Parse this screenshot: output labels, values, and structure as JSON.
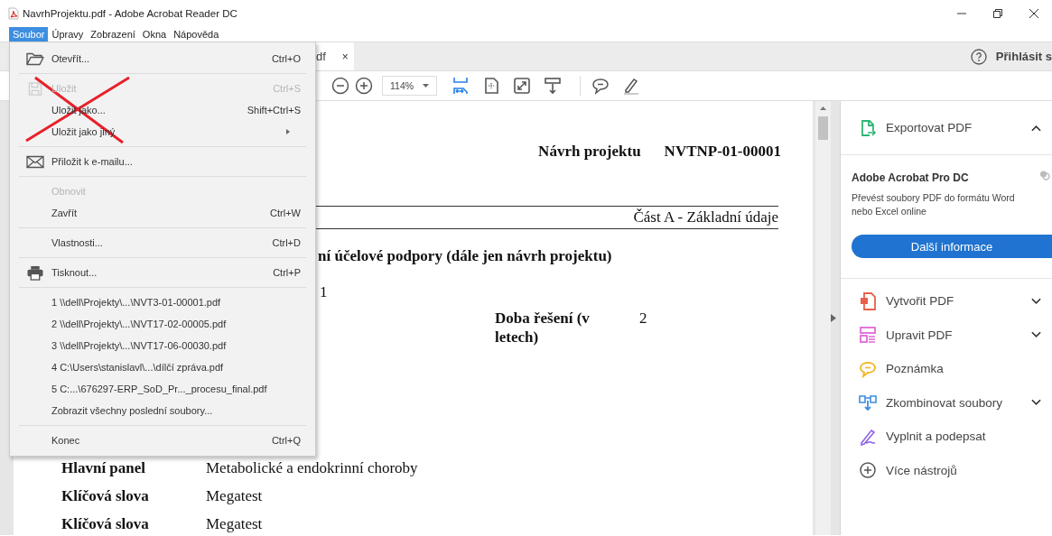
{
  "window": {
    "title": "NavrhProjektu.pdf - Adobe Acrobat Reader DC"
  },
  "menu_bar": [
    {
      "label": "Soubor",
      "selected": true
    },
    {
      "label": "Úpravy",
      "selected": false
    },
    {
      "label": "Zobrazení",
      "selected": false
    },
    {
      "label": "Okna",
      "selected": false
    },
    {
      "label": "Nápověda",
      "selected": false
    }
  ],
  "file_menu": {
    "groups": [
      [
        {
          "label": "Otevřít...",
          "shortcut": "Ctrl+O",
          "disabled": false,
          "submenu": false
        }
      ],
      [
        {
          "label": "Uložit",
          "shortcut": "Ctrl+S",
          "disabled": true,
          "submenu": false
        },
        {
          "label": "Uložit jako...",
          "shortcut": "Shift+Ctrl+S",
          "disabled": false,
          "submenu": false
        },
        {
          "label": "Uložit jako jiný",
          "disabled": false,
          "submenu": true
        }
      ],
      [
        {
          "label": "Přiložit k e-mailu...",
          "disabled": false,
          "submenu": false
        }
      ],
      [
        {
          "label": "Obnovit",
          "disabled": true,
          "submenu": false
        },
        {
          "label": "Zavřít",
          "shortcut": "Ctrl+W",
          "disabled": false,
          "submenu": false
        }
      ],
      [
        {
          "label": "Vlastnosti...",
          "shortcut": "Ctrl+D",
          "disabled": false,
          "submenu": false
        }
      ],
      [
        {
          "label": "Tisknout...",
          "shortcut": "Ctrl+P",
          "disabled": false,
          "submenu": false
        }
      ],
      [
        {
          "label": "1 \\\\dell\\Projekty\\...\\NVT3-01-00001.pdf",
          "disabled": false,
          "submenu": false
        },
        {
          "label": "2 \\\\dell\\Projekty\\...\\NVT17-02-00005.pdf",
          "disabled": false,
          "submenu": false
        },
        {
          "label": "3 \\\\dell\\Projekty\\...\\NVT17-06-00030.pdf",
          "disabled": false,
          "submenu": false
        },
        {
          "label": "4 C:\\Users\\stanislavl\\...\\dílčí zpráva.pdf",
          "disabled": false,
          "submenu": false
        },
        {
          "label": "5 C:...\\676297-ERP_SoD_Pr..._procesu_final.pdf",
          "disabled": false,
          "submenu": false
        },
        {
          "label": "Zobrazit všechny poslední soubory...",
          "disabled": false,
          "submenu": false
        }
      ],
      [
        {
          "label": "Konec",
          "shortcut": "Ctrl+Q",
          "disabled": false,
          "submenu": false
        }
      ]
    ]
  },
  "tab": {
    "label": "df",
    "close": "×"
  },
  "account": {
    "label": "Přihlásit s"
  },
  "toolbar": {
    "zoom": "114%",
    "view_buttons": [
      {
        "selected": true
      },
      {
        "selected": false
      },
      {
        "selected": false
      },
      {
        "selected": false
      }
    ]
  },
  "document": {
    "title": "Návrh projektu",
    "code": "NVTNP-01-00001",
    "section": "Část A - Základní údaje",
    "heading": "ní účelové podpory (dále jen návrh projektu)",
    "fragment": "1",
    "duration": {
      "label": "Doba řešení (v letech)",
      "value": "2"
    },
    "rows": [
      {
        "label": "Hlavní panel",
        "value": "Metabolické a endokrinní choroby"
      },
      {
        "label": "Klíčová slova",
        "value": "Megatest"
      },
      {
        "label": "Klíčová slova",
        "value": "Megatest"
      }
    ]
  },
  "right_panel": {
    "export": {
      "label": "Exportovat PDF",
      "expanded": true
    },
    "promo": {
      "title": "Adobe Acrobat Pro DC",
      "text": "Převést soubory PDF do formátu Word nebo Excel online",
      "button": "Další informace"
    },
    "tools": [
      {
        "label": "Vytvořit PDF",
        "submenu": true
      },
      {
        "label": "Upravit PDF",
        "submenu": true
      },
      {
        "label": "Poznámka",
        "submenu": false
      },
      {
        "label": "Zkombinovat soubory",
        "submenu": true
      },
      {
        "label": "Vyplnit a podepsat",
        "submenu": false
      },
      {
        "label": "Více nástrojů",
        "submenu": false
      }
    ]
  }
}
